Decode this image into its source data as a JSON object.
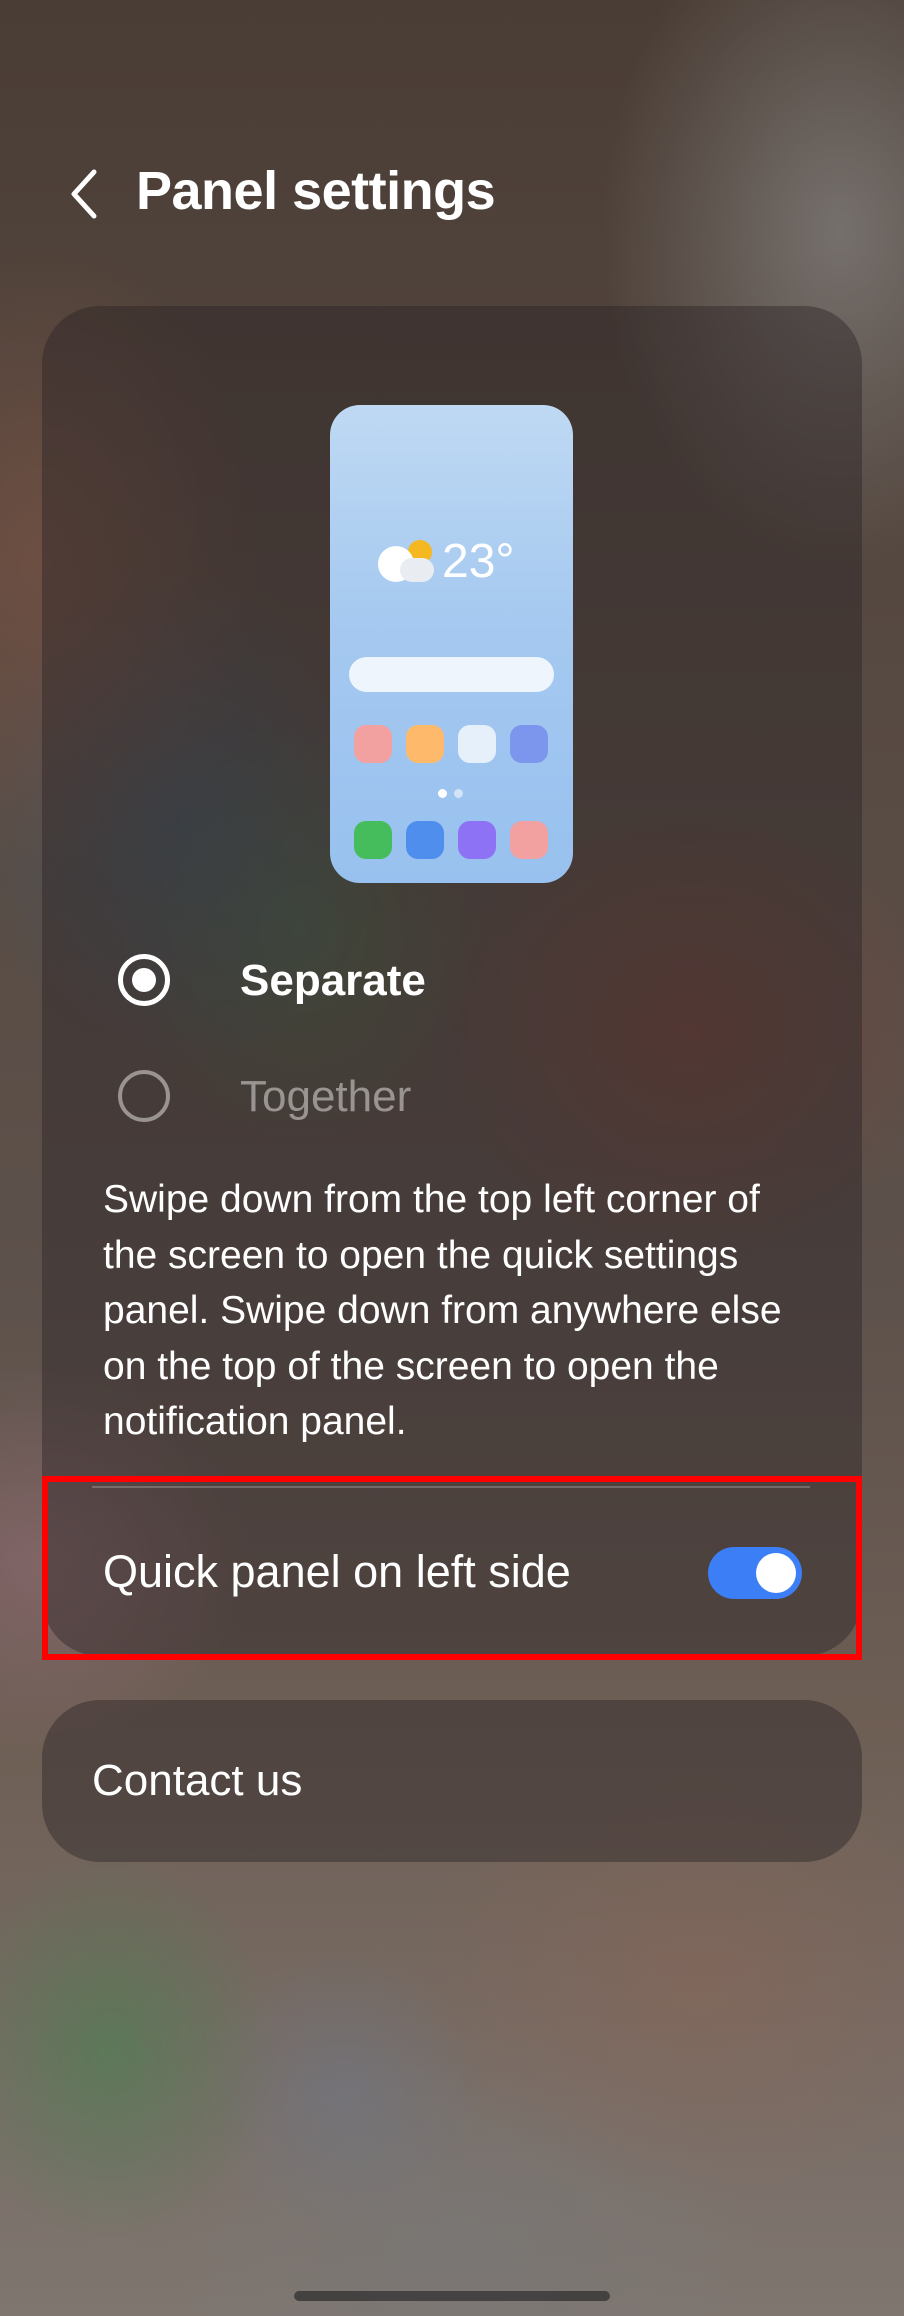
{
  "header": {
    "title": "Panel settings",
    "back_icon": "chevron-left-icon"
  },
  "preview": {
    "temperature": "23°",
    "weather_icon": "partly-cloudy-icon",
    "app_colors_row1": [
      "#f2a0a0",
      "#ffb96b",
      "#e6f0fa",
      "#7b96ec"
    ],
    "app_colors_row2": [
      "#46bd5d",
      "#4f8eec",
      "#8d72f5",
      "#f2a0a0"
    ]
  },
  "panel_mode": {
    "options": [
      {
        "label": "Separate",
        "selected": true
      },
      {
        "label": "Together",
        "selected": false
      }
    ],
    "description": "Swipe down from the top left corner of the screen to open the quick settings panel. Swipe down from anywhere else on the top of the screen to open the notification panel."
  },
  "quick_panel_left": {
    "label": "Quick panel on left side",
    "enabled": true,
    "accent": "#3c7ef5"
  },
  "contact": {
    "label": "Contact us"
  },
  "highlight_color": "#ff0000"
}
